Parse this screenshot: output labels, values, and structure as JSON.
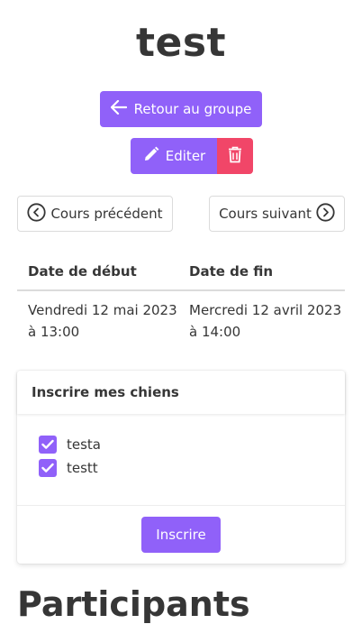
{
  "page": {
    "title": "test"
  },
  "actions": {
    "back_label": "Retour au groupe",
    "edit_label": "Editer",
    "prev_label": "Cours précédent",
    "next_label": "Cours suivant"
  },
  "schedule_table": {
    "headers": [
      "Date de début",
      "Date de fin"
    ],
    "row": [
      "Vendredi 12 mai 2023 à 13:00",
      "Mercredi 12 avril 2023 à 14:00"
    ]
  },
  "register_card": {
    "title": "Inscrire mes chiens",
    "dogs": [
      {
        "name": "testa",
        "checked": true
      },
      {
        "name": "testt",
        "checked": true
      }
    ],
    "submit_label": "Inscrire"
  },
  "participants": {
    "title": "Participants"
  },
  "colors": {
    "primary": "#9061f9",
    "danger": "#f14668",
    "text": "#363636"
  },
  "icons": [
    "arrow-left-icon",
    "pencil-icon",
    "trash-icon",
    "chevron-left-circle-icon",
    "chevron-right-circle-icon",
    "check-icon"
  ]
}
